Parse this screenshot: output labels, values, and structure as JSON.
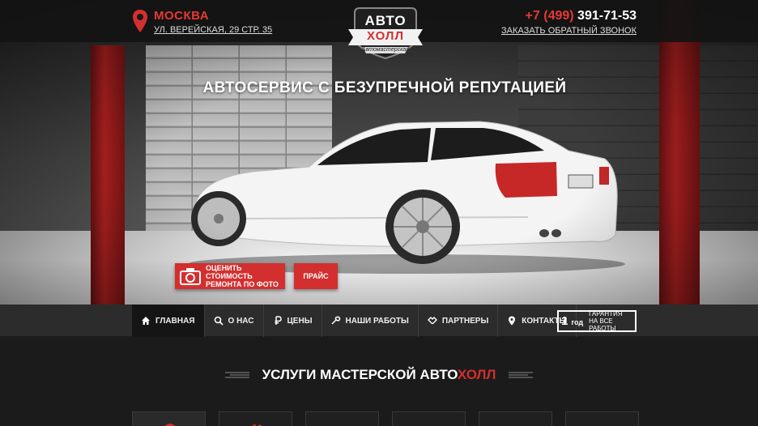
{
  "header": {
    "city": "Москва",
    "address": "ул. Верейская, 29 стр. 35",
    "phone_code": "+7 (499)",
    "phone_number": "391-71-53",
    "callback_label": "Заказать обратный звонок"
  },
  "logo": {
    "line1": "АВТО",
    "line2": "ХОЛЛ",
    "tagline": "Автомастерская"
  },
  "hero": {
    "headline": "Автосервис с безупречной репутацией",
    "photo_button_line1": "Оценить стоимость",
    "photo_button_line2": "ремонта по фото",
    "price_button": "Прайс"
  },
  "nav": {
    "items": [
      {
        "label": "Главная",
        "icon": "home-icon"
      },
      {
        "label": "О нас",
        "icon": "search-icon"
      },
      {
        "label": "Цены",
        "icon": "ruble-icon"
      },
      {
        "label": "Наши работы",
        "icon": "wrench-icon"
      },
      {
        "label": "Партнеры",
        "icon": "handshake-icon"
      },
      {
        "label": "Контакты",
        "icon": "location-icon"
      }
    ],
    "active_index": 0,
    "warranty": {
      "number": "1",
      "unit": "год",
      "line1": "гарантия",
      "line2": "на все работы"
    }
  },
  "services": {
    "title_prefix": "Услуги мастерской авто",
    "title_highlight": "холл"
  },
  "colors": {
    "accent": "#d32f2f",
    "nav_bg": "#2c2c2c",
    "page_bg": "#1b1b1b"
  }
}
